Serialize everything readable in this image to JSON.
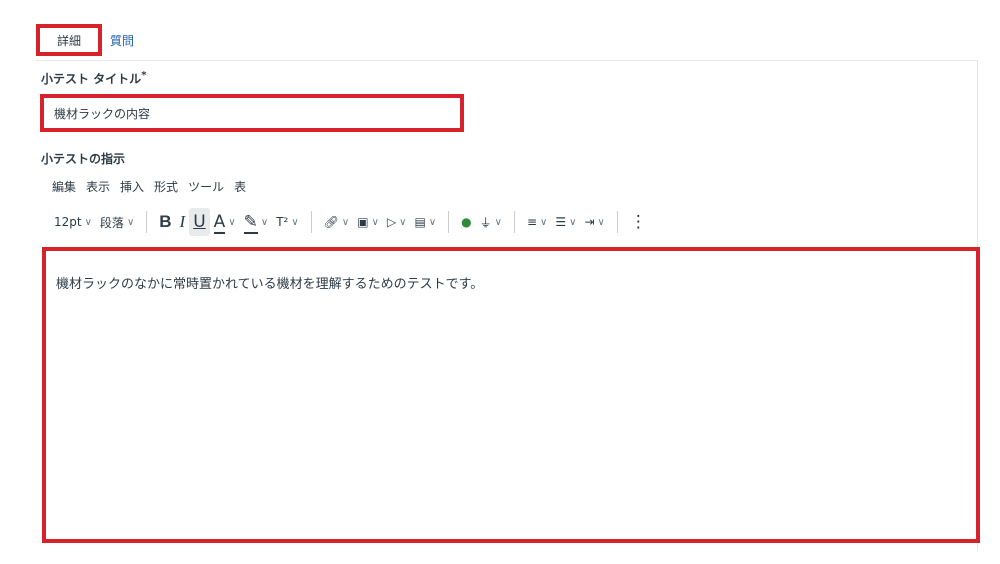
{
  "tabs": [
    {
      "label": "詳細"
    },
    {
      "label": "質問"
    }
  ],
  "quiz_title": {
    "label": "小テスト タイトル",
    "required_mark": "*",
    "value": "機材ラックの内容"
  },
  "instructions": {
    "label": "小テストの指示",
    "menubar": [
      "編集",
      "表示",
      "挿入",
      "形式",
      "ツール",
      "表"
    ],
    "toolbar": {
      "font_size": "12pt",
      "paragraph": "段落",
      "bold": "B",
      "italic": "I",
      "underline": "U",
      "text_color": "A",
      "superscript": "T²",
      "more": "⋮"
    },
    "content": "機材ラックのなかに常時置かれている機材を理解するためのテストです。"
  },
  "colors": {
    "highlight_border": "#d6232b",
    "link_blue": "#1f5fb0",
    "text": "#2d3b45"
  }
}
